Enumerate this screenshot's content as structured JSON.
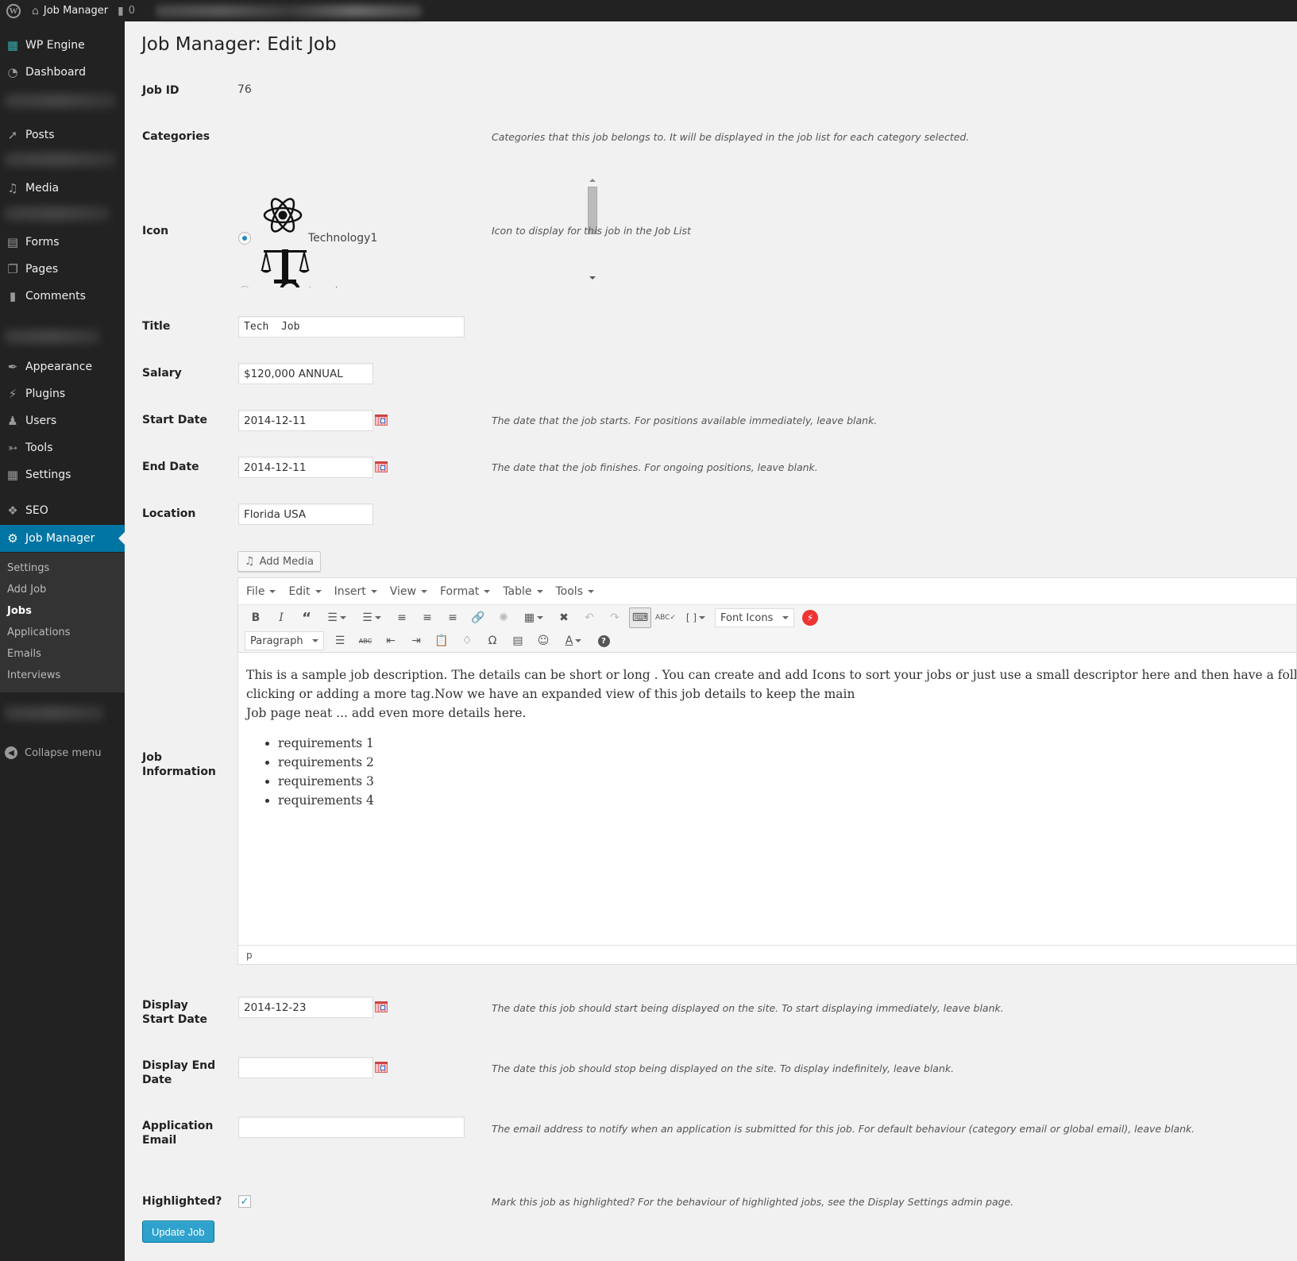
{
  "admin_bar": {
    "site_name": "Job Manager",
    "comments_count": "0",
    "icons": {
      "wp_logo": "wordpress-logo",
      "home": "home-icon",
      "comments": "comment-bubble-icon"
    }
  },
  "sidebar": {
    "items": [
      {
        "label": "WP Engine",
        "icon": "grid-icon"
      },
      {
        "label": "Dashboard",
        "icon": "dashboard-gauge-icon"
      },
      {
        "label": "Posts",
        "icon": "pushpin-icon"
      },
      {
        "label": "Media",
        "icon": "media-camera-music-icon"
      },
      {
        "label": "Forms",
        "icon": "form-icon"
      },
      {
        "label": "Pages",
        "icon": "pages-icon"
      },
      {
        "label": "Comments",
        "icon": "comment-icon"
      },
      {
        "label": "Appearance",
        "icon": "paintbrush-icon"
      },
      {
        "label": "Plugins",
        "icon": "plug-icon"
      },
      {
        "label": "Users",
        "icon": "user-icon"
      },
      {
        "label": "Tools",
        "icon": "wrench-icon"
      },
      {
        "label": "Settings",
        "icon": "sliders-icon"
      },
      {
        "label": "SEO",
        "icon": "seo-icon"
      },
      {
        "label": "Job Manager",
        "icon": "gear-icon",
        "current": true
      }
    ],
    "submenu": [
      {
        "label": "Settings"
      },
      {
        "label": "Add Job"
      },
      {
        "label": "Jobs",
        "current": true
      },
      {
        "label": "Applications"
      },
      {
        "label": "Emails"
      },
      {
        "label": "Interviews"
      }
    ],
    "collapse_label": "Collapse menu"
  },
  "page": {
    "title": "Job Manager: Edit Job",
    "fields": {
      "job_id": {
        "label": "Job ID",
        "value": "76"
      },
      "categories": {
        "label": "Categories",
        "description": "Categories that this job belongs to. It will be displayed in the job list for each category selected."
      },
      "icon": {
        "label": "Icon",
        "description": "Icon to display for this job in the Job List",
        "options": [
          {
            "label": "Technology1",
            "icon": "atom-icon",
            "selected": true
          },
          {
            "label": "Legal",
            "icon": "scales-of-justice-icon",
            "selected": false
          }
        ]
      },
      "title": {
        "label": "Title",
        "value": "Tech  Job"
      },
      "salary": {
        "label": "Salary",
        "value": "$120,000 ANNUAL"
      },
      "start_date": {
        "label": "Start Date",
        "value": "2014-12-11",
        "description": "The date that the job starts. For positions available immediately, leave blank."
      },
      "end_date": {
        "label": "End Date",
        "value": "2014-12-11",
        "description": "The date that the job finishes. For ongoing positions, leave blank."
      },
      "location": {
        "label": "Location",
        "value": "Florida USA"
      },
      "job_information": {
        "label": "Job Information"
      },
      "display_start_date": {
        "label": "Display Start Date",
        "value": "2014-12-23",
        "description": "The date this job should start being displayed on the site. To start displaying immediately, leave blank."
      },
      "display_end_date": {
        "label": "Display End Date",
        "value": "",
        "description": "The date this job should stop being displayed on the site. To display indefinitely, leave blank."
      },
      "application_email": {
        "label": "Application Email",
        "value": "",
        "description": "The email address to notify when an application is submitted for this job. For default behaviour (category email or global email), leave blank."
      },
      "highlighted": {
        "label": "Highlighted?",
        "checked": true,
        "description": "Mark this job as highlighted? For the behaviour of highlighted jobs, see the Display Settings admin page."
      }
    },
    "editor": {
      "add_media_label": "Add Media",
      "menus": [
        "File",
        "Edit",
        "Insert",
        "View",
        "Format",
        "Table",
        "Tools"
      ],
      "font_icons_label": "Font Icons",
      "paragraph_label": "Paragraph",
      "content": {
        "line1": "This is a sample job description. The details can be short or long . You can create and add Icons to sort your jobs or just use a small descriptor here  and then have a follow on page with more",
        "line2": "clicking or adding a more  tag.Now we have an expanded view of this job details to keep the main",
        "line3": "Job page neat ... add even more details here.",
        "list": [
          "requirements 1",
          "requirements 2",
          "requirements 3",
          "requirements 4"
        ]
      },
      "status_path": "p"
    },
    "submit_label": "Update Job"
  }
}
